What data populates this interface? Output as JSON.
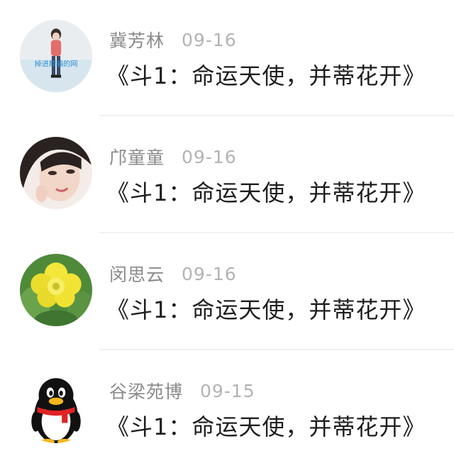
{
  "comments": [
    {
      "name": "冀芳林",
      "date": "09-16",
      "text": "《斗1：命运天使，并蒂花开》",
      "avatar_caption": "掉进欺骗的网",
      "avatar_icon": "girl-photo-avatar"
    },
    {
      "name": "邝童童",
      "date": "09-16",
      "text": "《斗1：命运天使，并蒂花开》",
      "avatar_icon": "woman-selfie-avatar"
    },
    {
      "name": "闵思云",
      "date": "09-16",
      "text": "《斗1：命运天使，并蒂花开》",
      "avatar_icon": "yellow-flower-avatar"
    },
    {
      "name": "谷梁苑博",
      "date": "09-15",
      "text": "《斗1：命运天使，并蒂花开》",
      "avatar_icon": "qq-penguin-avatar"
    }
  ]
}
